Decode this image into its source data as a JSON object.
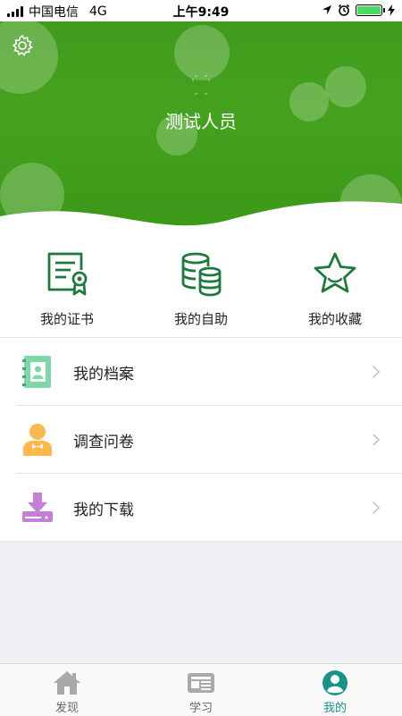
{
  "status_bar": {
    "carrier": "中国电信",
    "network": "4G",
    "time": "上午9:49"
  },
  "profile": {
    "name": "测试人员",
    "settings_icon": "gear-icon"
  },
  "quick_actions": [
    {
      "label": "我的证书",
      "icon": "certificate-icon"
    },
    {
      "label": "我的自助",
      "icon": "database-icon"
    },
    {
      "label": "我的收藏",
      "icon": "star-icon"
    }
  ],
  "list": [
    {
      "label": "我的档案",
      "icon": "archive-book-icon"
    },
    {
      "label": "调查问卷",
      "icon": "survey-person-icon"
    },
    {
      "label": "我的下载",
      "icon": "download-icon"
    }
  ],
  "tabs": [
    {
      "label": "发现",
      "icon": "home-icon",
      "active": false
    },
    {
      "label": "学习",
      "icon": "newspaper-icon",
      "active": false
    },
    {
      "label": "我的",
      "icon": "user-icon",
      "active": true
    }
  ],
  "colors": {
    "header_green": "#45a21f",
    "icon_green": "#1e7a3c",
    "active_tab": "#19938a"
  }
}
